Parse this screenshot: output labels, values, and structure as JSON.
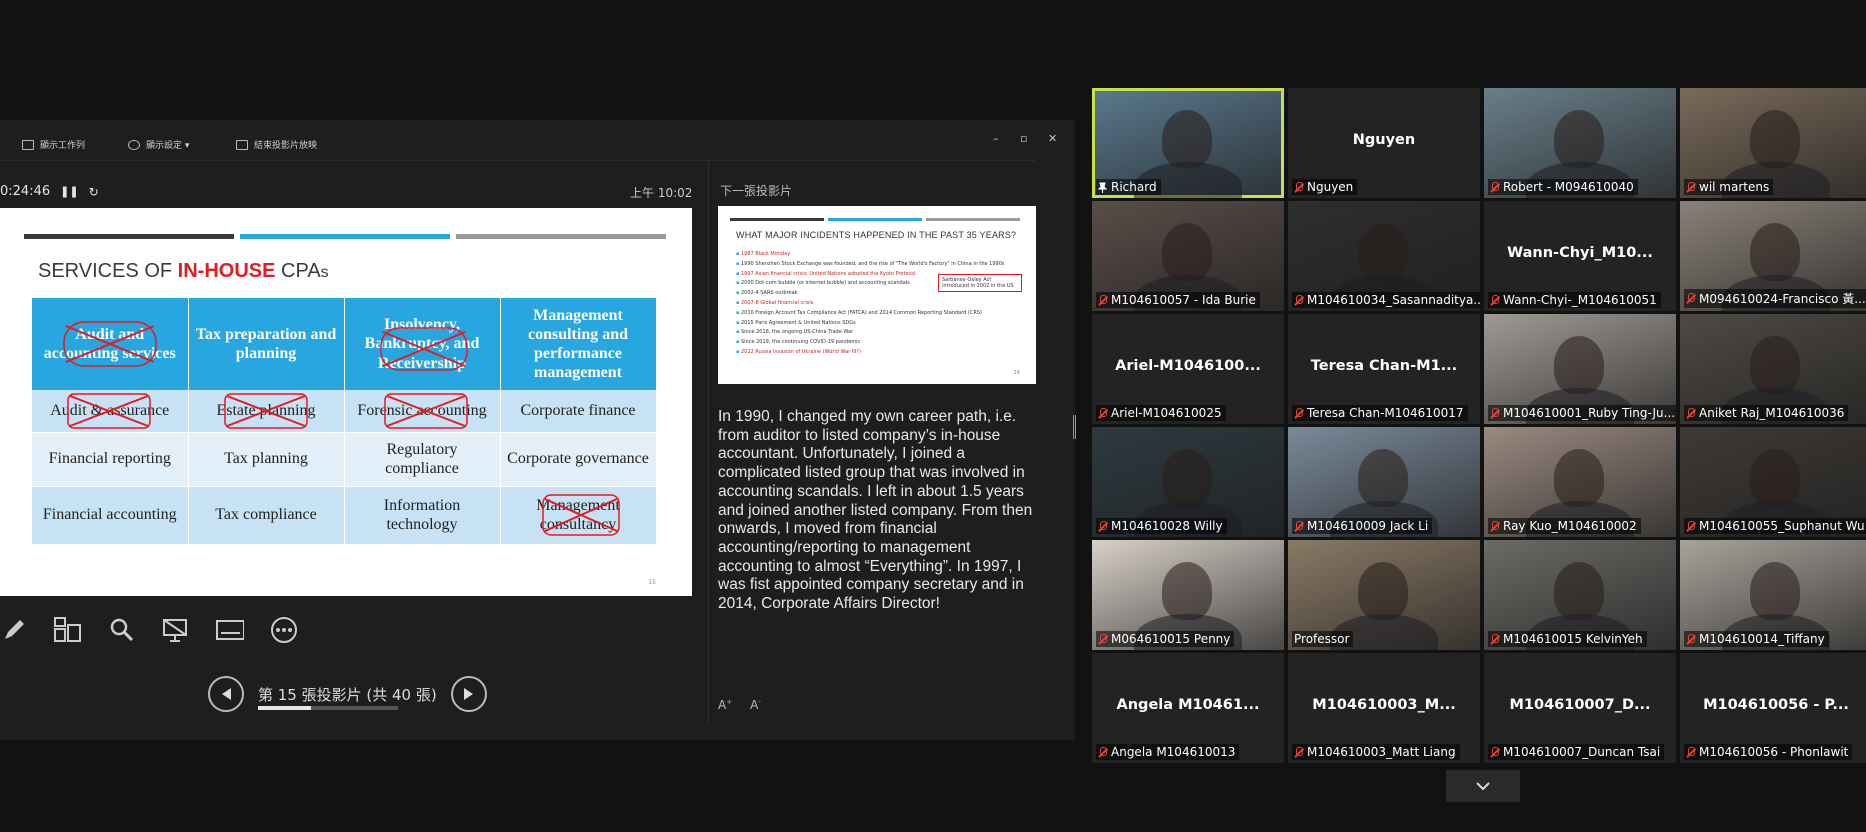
{
  "presenter": {
    "toolbar": {
      "show_taskbar": "顯示工作列",
      "display_settings": "顯示設定 ▾",
      "end_show": "結束投影片放映"
    },
    "window_controls": {
      "minimize": "–",
      "restore": "▫",
      "close": "✕"
    },
    "timer": "0:24:46",
    "clock": "上午 10:02",
    "next_slide_label": "下一張投影片",
    "slide_counter": "第 15 張投影片 (共 40 張)",
    "progress_fraction": 0.375,
    "font_increase": "A",
    "font_decrease": "A",
    "notes": "In 1990, I changed my own career path, i.e. from auditor to listed company’s in-house accountant.  Unfortunately, I joined a complicated listed group that was involved in accounting scandals. I left in about 1.5 years and joined another listed company. From then onwards, I moved from financial accounting/reporting to management accounting to almost “Everything”. In 1997, I was fist appointed company secretary and in 2014, Corporate Affairs Director!"
  },
  "slide": {
    "title_pre": "SERVICES OF ",
    "title_accent": "IN-HOUSE",
    "title_post": " CPA",
    "title_suffix": "s",
    "bar_colors": [
      "#3a3a3a",
      "#27a6e0",
      "#9a9a9a"
    ],
    "headers": [
      "Audit and accounting services",
      "Tax preparation and planning",
      "Insolvency, Bankruptcy, and Receivership",
      "Management consulting and performance management"
    ],
    "rows": [
      [
        "Audit & assurance",
        "Estate planning",
        "Forensic accounting",
        "Corporate finance"
      ],
      [
        "Financial reporting",
        "Tax planning",
        "Regulatory compliance",
        "Corporate governance"
      ],
      [
        "Financial accounting",
        "Tax compliance",
        "Information technology",
        "Management consultancy"
      ]
    ],
    "page_number": "15"
  },
  "next_slide": {
    "title": "WHAT MAJOR INCIDENTS HAPPENED IN THE PAST 35 YEARS?",
    "items": [
      "1987 Black Monday",
      "1990 Shenzhen Stock Exchange was founded, and the rise of \"The World's Factory\" in China in the 1990s",
      "1997 Asian financial crisis; United Nations adopted the Kyoto Protocol",
      "2000 Dot-com bubble (or internet bubble) and accounting scandals",
      "2002-4 SARS outbreak",
      "2007-8 Global financial crisis",
      "2010 Foreign Account Tax Compliance Act (FATCA) and 2014 Common Reporting Standard (CRS)",
      "2015 Paris Agreement & United Nations SDGs",
      "Since 2018, the ongoing US-China Trade War",
      "Since 2019, the continuing COVID-19 pandemic",
      "2022 Russia invasion of Ukraine (World War III?)"
    ],
    "box_text": "Sarbanes-Oxley Act introduced in 2002 in the US",
    "page_number": "16"
  },
  "participants": [
    {
      "name": "Richard",
      "big": "",
      "muted": false,
      "pinned": true,
      "video": true,
      "bg": "#5b7a8f"
    },
    {
      "name": "Nguyen",
      "big": "Nguyen",
      "muted": true,
      "video": false
    },
    {
      "name": "Robert - M094610040",
      "big": "",
      "muted": true,
      "video": true,
      "bg": "#6a7f8a"
    },
    {
      "name": "wil martens",
      "big": "",
      "muted": true,
      "video": true,
      "bg": "#7a6a5a"
    },
    {
      "name": "M104610057 - Ida Burie",
      "big": "",
      "muted": true,
      "video": true,
      "bg": "#5a4d48"
    },
    {
      "name": "M104610034_Sasannaditya...",
      "big": "",
      "muted": true,
      "video": true,
      "bg": "#2e2e2e"
    },
    {
      "name": "Wann-Chyi-_M104610051",
      "big": "Wann-Chyi_M10...",
      "muted": true,
      "video": false
    },
    {
      "name": "M094610024-Francisco 黃...",
      "big": "",
      "muted": true,
      "video": true,
      "bg": "#8a8278"
    },
    {
      "name": "Ariel-M104610025",
      "big": "Ariel-M1046100...",
      "muted": true,
      "video": false
    },
    {
      "name": "Teresa Chan-M104610017",
      "big": "Teresa  Chan-M1...",
      "muted": true,
      "video": false
    },
    {
      "name": "M104610001_Ruby Ting-Ju...",
      "big": "",
      "muted": true,
      "video": true,
      "bg": "#a09a94"
    },
    {
      "name": "Aniket Raj_M104610036",
      "big": "",
      "muted": true,
      "video": true,
      "bg": "#4e4a44"
    },
    {
      "name": "M104610028 Willy",
      "big": "",
      "muted": true,
      "video": true,
      "bg": "#2d3a40"
    },
    {
      "name": "M104610009 Jack Li",
      "big": "",
      "muted": true,
      "video": true,
      "bg": "#7a8a9a"
    },
    {
      "name": "Ray Kuo_M104610002",
      "big": "",
      "muted": true,
      "video": true,
      "bg": "#9a8a80"
    },
    {
      "name": "M104610055_Suphanut Wu...",
      "big": "",
      "muted": true,
      "video": true,
      "bg": "#3e3a36"
    },
    {
      "name": "M064610015 Penny",
      "big": "",
      "muted": true,
      "video": true,
      "bg": "#d8d0c8"
    },
    {
      "name": "Professor",
      "big": "",
      "muted": false,
      "video": true,
      "bg": "#8a7a66"
    },
    {
      "name": "M104610015 KelvinYeh",
      "big": "",
      "muted": true,
      "video": true,
      "bg": "#6a6a66"
    },
    {
      "name": "M104610014_Tiffany",
      "big": "",
      "muted": true,
      "video": true,
      "bg": "#a8a29a"
    },
    {
      "name": "Angela M104610013",
      "big": "Angela  M10461...",
      "muted": true,
      "video": false
    },
    {
      "name": "M104610003_Matt Liang",
      "big": "M104610003_M...",
      "muted": true,
      "video": false
    },
    {
      "name": "M104610007_Duncan Tsai",
      "big": "M104610007_D...",
      "muted": true,
      "video": false
    },
    {
      "name": "M104610056 - Phonlawit",
      "big": "M104610056 - P...",
      "muted": true,
      "video": false
    }
  ],
  "colors": {
    "accent": "#27a6e0",
    "brand_red": "#e31b23",
    "active_speaker": "#c6e04a",
    "muted": "#e0443a"
  }
}
